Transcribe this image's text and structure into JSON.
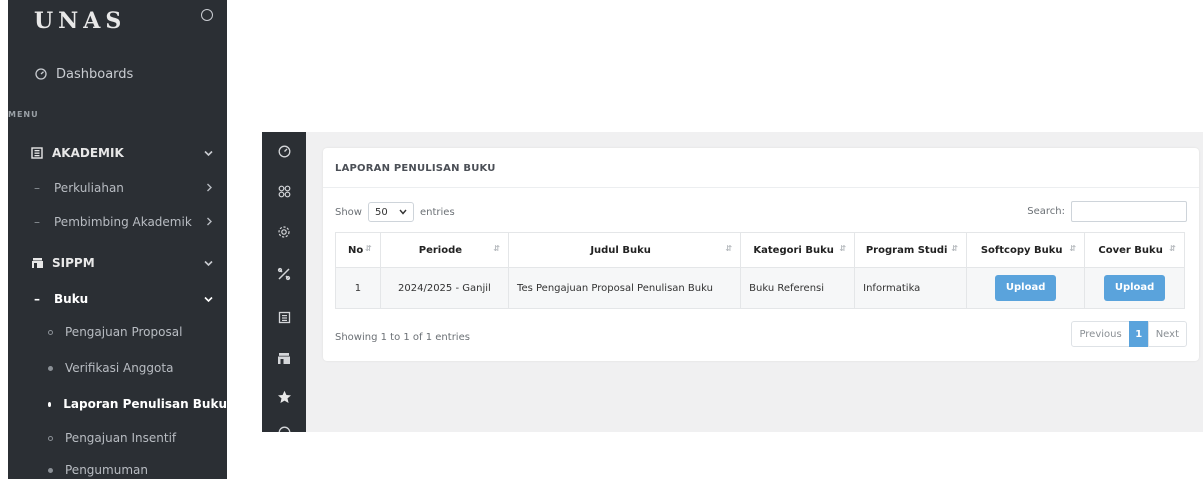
{
  "brand": {
    "name": "UNAS"
  },
  "sidebar": {
    "dashboard_label": "Dashboards",
    "menu_header": "MENU",
    "akademik": {
      "label": "AKADEMIK",
      "items": [
        "Perkuliahan",
        "Pembimbing Akademik"
      ]
    },
    "sippm": {
      "label": "SIPPM",
      "buku": {
        "label": "Buku",
        "items": [
          "Pengajuan Proposal",
          "Verifikasi Anggota",
          "Laporan Penulisan Buku",
          "Pengajuan Insentif",
          "Pengumuman"
        ],
        "active": "Laporan Penulisan Buku"
      }
    }
  },
  "mini_sidebar": {
    "icons": [
      "dashboard-icon",
      "apps-icon",
      "settings-icon",
      "tools-icon",
      "building-icon",
      "shop-icon",
      "star-icon"
    ]
  },
  "card": {
    "title": "LAPORAN PENULISAN BUKU",
    "show_label": "Show",
    "entries_label": "entries",
    "entries_value": "50",
    "search_label": "Search:",
    "search_value": ""
  },
  "table": {
    "headers": [
      "No",
      "Periode",
      "Judul Buku",
      "Kategori Buku",
      "Program Studi",
      "Softcopy Buku",
      "Cover Buku"
    ],
    "rows": [
      {
        "no": "1",
        "periode": "2024/2025 - Ganjil",
        "judul": "Tes Pengajuan Proposal Penulisan Buku",
        "kategori": "Buku Referensi",
        "prodi": "Informatika",
        "softcopy": "Upload",
        "cover": "Upload"
      }
    ]
  },
  "footer": {
    "info": "Showing 1 to 1 of 1 entries",
    "previous": "Previous",
    "page": "1",
    "next": "Next"
  },
  "colors": {
    "sidebar_bg": "#2b2f34",
    "accent": "#5aa3dc",
    "content_bg": "#f0f0f1"
  }
}
